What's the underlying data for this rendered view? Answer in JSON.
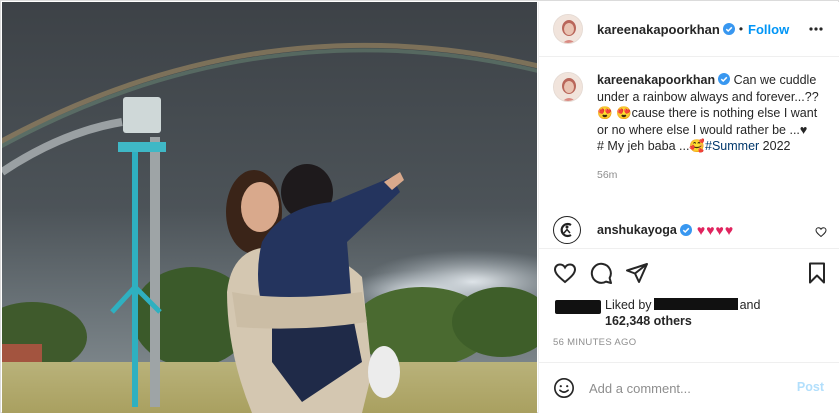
{
  "post": {
    "username": "kareenakapoorkhan",
    "verified": true,
    "separator": "•",
    "follow_label": "Follow",
    "more_icon": "more-horizontal-icon",
    "caption": {
      "username": "kareenakapoorkhan",
      "text_part1": " Can we cuddle under a rainbow always and forever...??",
      "emoji1": "😍",
      "emoji2": "😍",
      "text_part2": "cause there is nothing else I want or no where else I would rather be ...",
      "heart": "♥",
      "text_part3": "# My jeh baba ...",
      "emoji3": "🥰",
      "hashtag": "#Summer",
      "year": " 2022"
    },
    "caption_time": "56m",
    "comment": {
      "username": "anshukayoga",
      "text": "♥♥♥♥"
    },
    "likes": {
      "prefix": "Liked by",
      "suffix": "and",
      "count": "162,348 others"
    },
    "posted_ago": "56 MINUTES AGO",
    "add_comment_placeholder": "Add a comment...",
    "post_label": "Post"
  },
  "colors": {
    "link": "#0095f6",
    "hashtag": "#00376b",
    "muted": "#8e8e8e",
    "heart": "#e0245e",
    "post_disabled": "#b2dffc"
  }
}
